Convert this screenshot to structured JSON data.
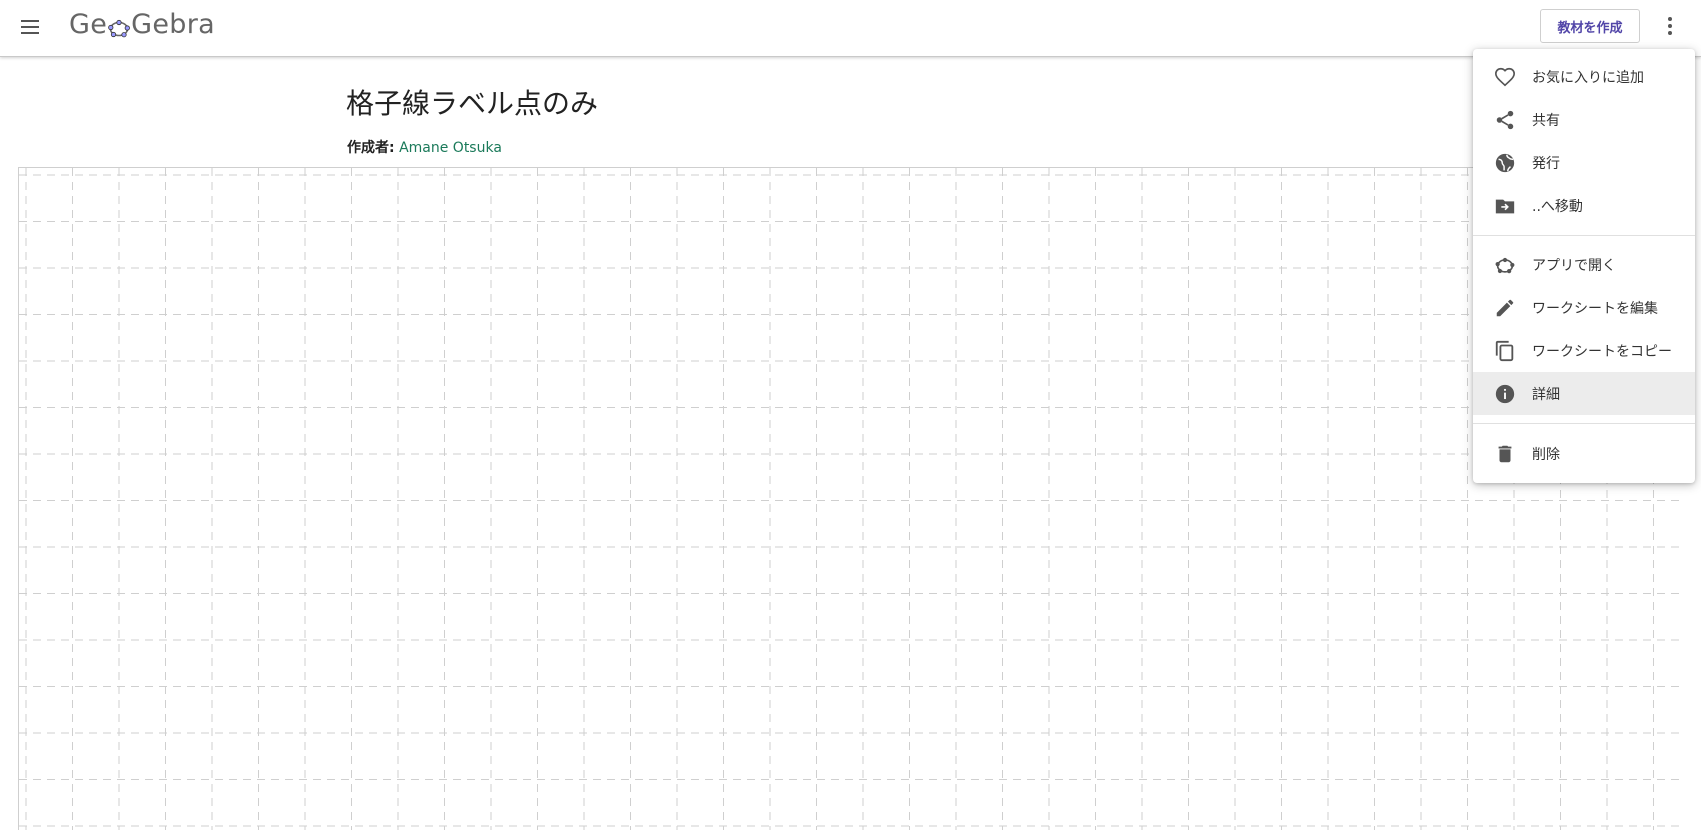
{
  "header": {
    "logo_text_left": "Ge",
    "logo_text_right": "Gebra",
    "create_button_label": "教材を作成",
    "colors": {
      "create_button_text": "#5145a8"
    }
  },
  "page": {
    "title": "格子線ラベル点のみ",
    "author_label": "作成者:",
    "author_name": "Amane Otsuka",
    "author_color": "#1b7a5a"
  },
  "menu": {
    "items": [
      {
        "label": "お気に入りに追加",
        "icon": "heart-outline-icon"
      },
      {
        "label": "共有",
        "icon": "share-icon"
      },
      {
        "label": "発行",
        "icon": "globe-icon"
      },
      {
        "label": "..へ移動",
        "icon": "folder-move-icon"
      },
      {
        "label": "アプリで開く",
        "icon": "geogebra-app-icon"
      },
      {
        "label": "ワークシートを編集",
        "icon": "pencil-icon"
      },
      {
        "label": "ワークシートをコピー",
        "icon": "copy-icon"
      },
      {
        "label": "詳細",
        "icon": "info-icon",
        "highlighted": true
      },
      {
        "label": "削除",
        "icon": "trash-icon"
      }
    ]
  }
}
